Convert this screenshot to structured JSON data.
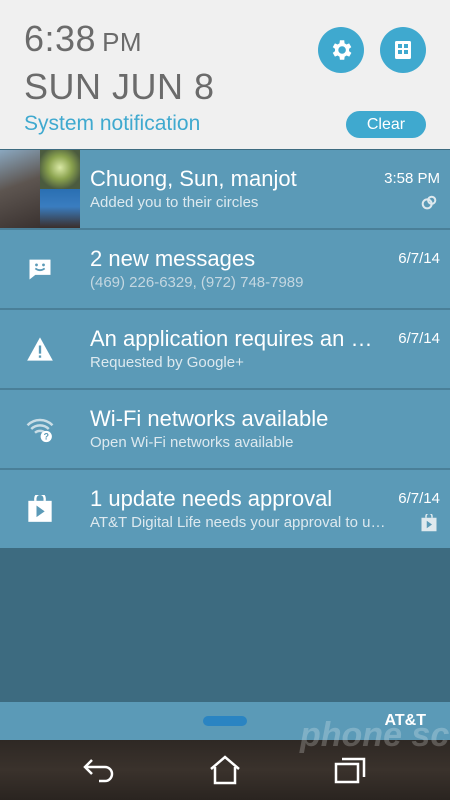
{
  "header": {
    "time": "6:38",
    "ampm": "PM",
    "date": "SUN JUN 8",
    "section_label": "System notification",
    "clear_label": "Clear",
    "settings_icon": "gear-icon",
    "quick_settings_icon": "grid-icon"
  },
  "notifications": [
    {
      "title": "Chuong, Sun, manjot",
      "subtitle": "Added you to their circles",
      "time": "3:58 PM",
      "icon": "avatars"
    },
    {
      "title": "2 new messages",
      "subtitle": "(469) 226-6329, (972) 748-7989",
      "time": "6/7/14",
      "icon": "message-icon"
    },
    {
      "title": "An application requires an update",
      "subtitle": "Requested by Google+",
      "time": "6/7/14",
      "icon": "warning-icon"
    },
    {
      "title": "Wi-Fi networks available",
      "subtitle": "Open Wi-Fi networks available",
      "time": "",
      "icon": "wifi-icon"
    },
    {
      "title": "1 update needs approval",
      "subtitle": "AT&T Digital Life needs your approval to update",
      "time": "6/7/14",
      "icon": "play-store-icon"
    }
  ],
  "status": {
    "carrier": "AT&T"
  },
  "watermark": "phone scoop",
  "colors": {
    "accent": "#3fa9cf",
    "notification_bg": "#5b9ab7",
    "empty_bg": "#3d6b80"
  }
}
